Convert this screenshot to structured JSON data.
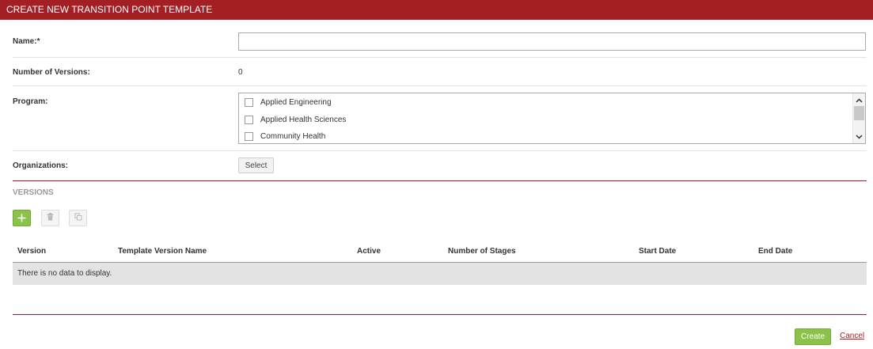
{
  "header": {
    "title": "CREATE NEW TRANSITION POINT TEMPLATE"
  },
  "form": {
    "name_label": "Name:*",
    "name_value": "",
    "num_versions_label": "Number of Versions:",
    "num_versions_value": "0",
    "program_label": "Program:",
    "programs": [
      {
        "label": "Applied Engineering",
        "checked": false
      },
      {
        "label": "Applied Health Sciences",
        "checked": false
      },
      {
        "label": "Community Health",
        "checked": false
      }
    ],
    "organizations_label": "Organizations:",
    "select_button": "Select"
  },
  "versions": {
    "title": "VERSIONS",
    "toolbar": {
      "add_icon": "plus-icon",
      "delete_icon": "trash-icon",
      "copy_icon": "copy-icon"
    },
    "columns": [
      "Version",
      "Template Version Name",
      "Active",
      "Number of Stages",
      "Start Date",
      "End Date"
    ],
    "empty_text": "There is no data to display."
  },
  "footer": {
    "create_label": "Create",
    "cancel_label": "Cancel"
  },
  "colors": {
    "accent": "#a31f23",
    "green": "#8bc24a"
  }
}
